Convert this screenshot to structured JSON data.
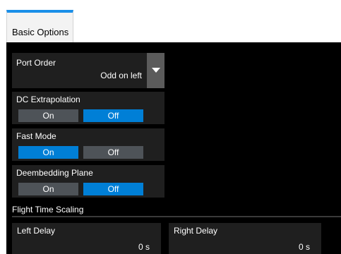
{
  "tab": {
    "label": "Basic Options"
  },
  "port_order": {
    "label": "Port Order",
    "value": "Odd on left"
  },
  "dc_extrapolation": {
    "label": "DC Extrapolation",
    "on": "On",
    "off": "Off",
    "selected": "off"
  },
  "fast_mode": {
    "label": "Fast Mode",
    "on": "On",
    "off": "Off",
    "selected": "on"
  },
  "deembedding_plane": {
    "label": "Deembedding Plane",
    "on": "On",
    "off": "Off",
    "selected": "off"
  },
  "flight_time_scaling": {
    "title": "Flight Time Scaling",
    "left_delay": {
      "label": "Left Delay",
      "value": "0 s"
    },
    "right_delay": {
      "label": "Right Delay",
      "value": "0 s"
    }
  },
  "colors": {
    "accent": "#1a8fe8",
    "selected": "#007fd6",
    "unselected": "#4e5358",
    "panel": "#000000",
    "group": "#1f1f1f"
  }
}
